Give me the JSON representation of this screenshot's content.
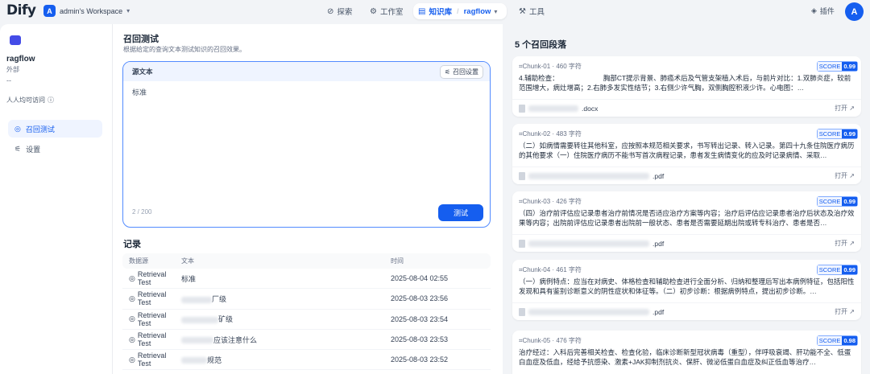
{
  "topbar": {
    "logo": "Dify",
    "workspace_initial": "A",
    "workspace_name": "admin's Workspace",
    "nav_explore": "探索",
    "nav_studio": "工作室",
    "nav_knowledge": "知识库",
    "nav_knowledge_sub": "ragflow",
    "nav_tools": "工具",
    "plugins": "插件",
    "avatar": "A"
  },
  "sidebar": {
    "dataset_name": "ragflow",
    "dataset_type": "外部",
    "dash": "--",
    "permission": "人人均可访问",
    "items": [
      {
        "label": "召回测试"
      },
      {
        "label": "设置"
      }
    ]
  },
  "main": {
    "title": "召回测试",
    "subtitle": "根据给定的查询文本测试知识的召回效果。",
    "query_label": "源文本",
    "settings_button": "召回设置",
    "query_text": "标准",
    "char_count": "2 / 200",
    "test_button": "测试",
    "records_title": "记录",
    "columns": [
      "数据源",
      "文本",
      "时间"
    ],
    "rows": [
      {
        "source": "Retrieval Test",
        "text": "标准",
        "time": "2025-08-04 02:55"
      },
      {
        "source": "Retrieval Test",
        "text": "厂级",
        "time": "2025-08-03 23:56"
      },
      {
        "source": "Retrieval Test",
        "text": "矿级",
        "time": "2025-08-03 23:54"
      },
      {
        "source": "Retrieval Test",
        "text": "应该注意什么",
        "time": "2025-08-03 23:53"
      },
      {
        "source": "Retrieval Test",
        "text": "规范",
        "time": "2025-08-03 23:52"
      }
    ]
  },
  "results": {
    "title": "5 个召回段落",
    "score_label": "SCORE",
    "open_label": "打开",
    "cards": [
      {
        "chunk": "Chunk-01",
        "chars": "460 字符",
        "score": "0.99",
        "text": "4.辅助检查：　　　　　　　胸部CT提示背景、肺癌术后及气管支架植入术后，与前片对比：1.双肺炎症，较前范围增大，病灶增高；2.右肺多发实性结节；3.右侧少许气胸，双侧胸腔积液少许。心电图：…",
        "file": ".docx"
      },
      {
        "chunk": "Chunk-02",
        "chars": "483 字符",
        "score": "0.99",
        "text": "（二）如病情需要转往其他科室，应按照本规范相关要求，书写转出记录、转入记录。第四十九条住院医疗病历的其他要求（一）住院医疗病历不能书写首次病程记录，患者发生病情变化的应及时记录病情、采取…",
        "file": ".pdf"
      },
      {
        "chunk": "Chunk-03",
        "chars": "426 字符",
        "score": "0.99",
        "text": "（四）治疗前评估应记录患者治疗前情况是否适应治疗方案等内容；治疗后评估应记录患者治疗后状态及治疗效果等内容；出院前评估应记录患者出院前一般状态、患者是否需要延期出院或转专科治疗、患者是否…",
        "file": ".pdf"
      },
      {
        "chunk": "Chunk-04",
        "chars": "461 字符",
        "score": "0.99",
        "text": "（一）病例特点：应当在对病史、体格检查和辅助检查进行全面分析、归纳和整理后写出本病例特征，包括阳性发现和具有鉴别诊断意义的阴性症状和体征等。（二）初步诊断：根据病例特点，提出初步诊断。…",
        "file": ".pdf"
      },
      {
        "chunk": "Chunk-05",
        "chars": "476 字符",
        "score": "0.98",
        "text": "治疗经过：入科后完善相关检查、检查化验，临床诊断新型冠状病毒（重型），伴呼吸衰竭、肝功能不全、低蛋白血症及低血，经给予抗感染、激素+JAK抑制剂抗炎、保肝、微泌低蛋白血症及纠正低血等治疗…",
        "file": ""
      }
    ]
  }
}
